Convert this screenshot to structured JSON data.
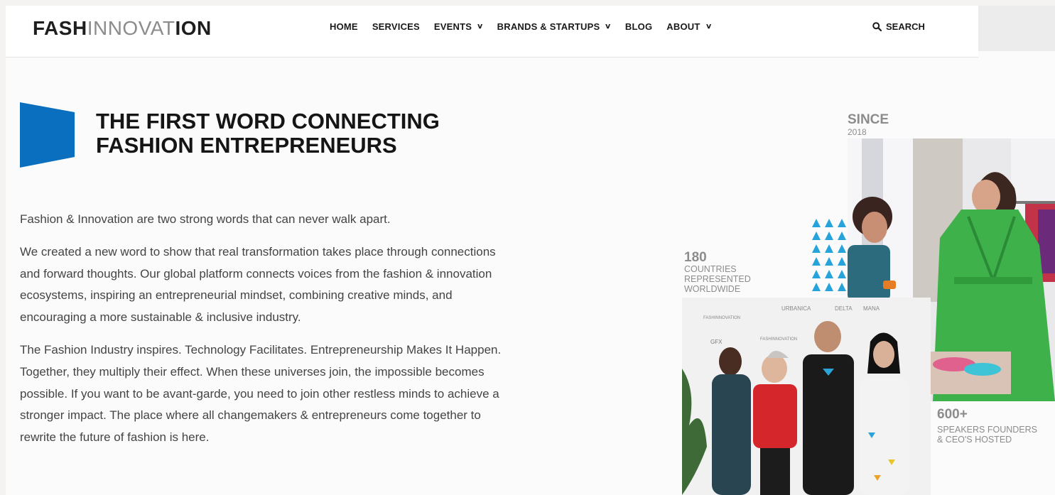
{
  "header": {
    "logo": {
      "part1": "FASH",
      "part2": "INNOVAT",
      "part3": "ION"
    },
    "nav": [
      {
        "label": "HOME",
        "has_dropdown": false
      },
      {
        "label": "SERVICES",
        "has_dropdown": false
      },
      {
        "label": "EVENTS",
        "has_dropdown": true
      },
      {
        "label": "BRANDS & STARTUPS",
        "has_dropdown": true
      },
      {
        "label": "BLOG",
        "has_dropdown": false
      },
      {
        "label": "ABOUT",
        "has_dropdown": true
      }
    ],
    "search_label": "SEARCH",
    "search_icon": "search-icon",
    "dropdown_icon": "chevron-down-icon"
  },
  "hero": {
    "title_line1": "THE FIRST WORD CONNECTING",
    "title_line2": "FASHION ENTREPRENEURS",
    "mark_color": "#0a6fbf"
  },
  "body": {
    "paragraphs": [
      "Fashion & Innovation are two strong words that can never walk apart.",
      "We created a new word to show that real transformation takes place through connections and forward thoughts. Our global platform connects voices from the fashion & innovation ecosystems, inspiring an entrepreneurial mindset, combining creative minds, and encouraging a more sustainable & inclusive industry.",
      "The Fashion Industry inspires. Technology Facilitates. Entrepreneurship Makes It Happen. Together, they multiply their effect. When these universes join, the impossible becomes possible. If you want to be avant-garde, you need to join other restless minds to achieve a stronger impact. The place where all changemakers & entrepreneurs come together to rewrite the future of fashion is here."
    ]
  },
  "collage": {
    "since": {
      "label": "SINCE",
      "year": "2018"
    },
    "stat_countries": {
      "number": "180",
      "line1": "COUNTRIES",
      "line2": "REPRESENTED",
      "line3": "WORLDWIDE"
    },
    "stat_speakers": {
      "number": "600+",
      "line1": "SPEAKERS FOUNDERS",
      "line2": "& CEO'S HOSTED"
    },
    "triangle_color": "#27a3db",
    "photo_top_alt": "Two women in a fashion showroom, one wearing a green quilted coat",
    "photo_bottom_alt": "Group of four people posing at a Fashinnovation event backdrop",
    "backdrop_logo": "FASHINNOVATION"
  }
}
